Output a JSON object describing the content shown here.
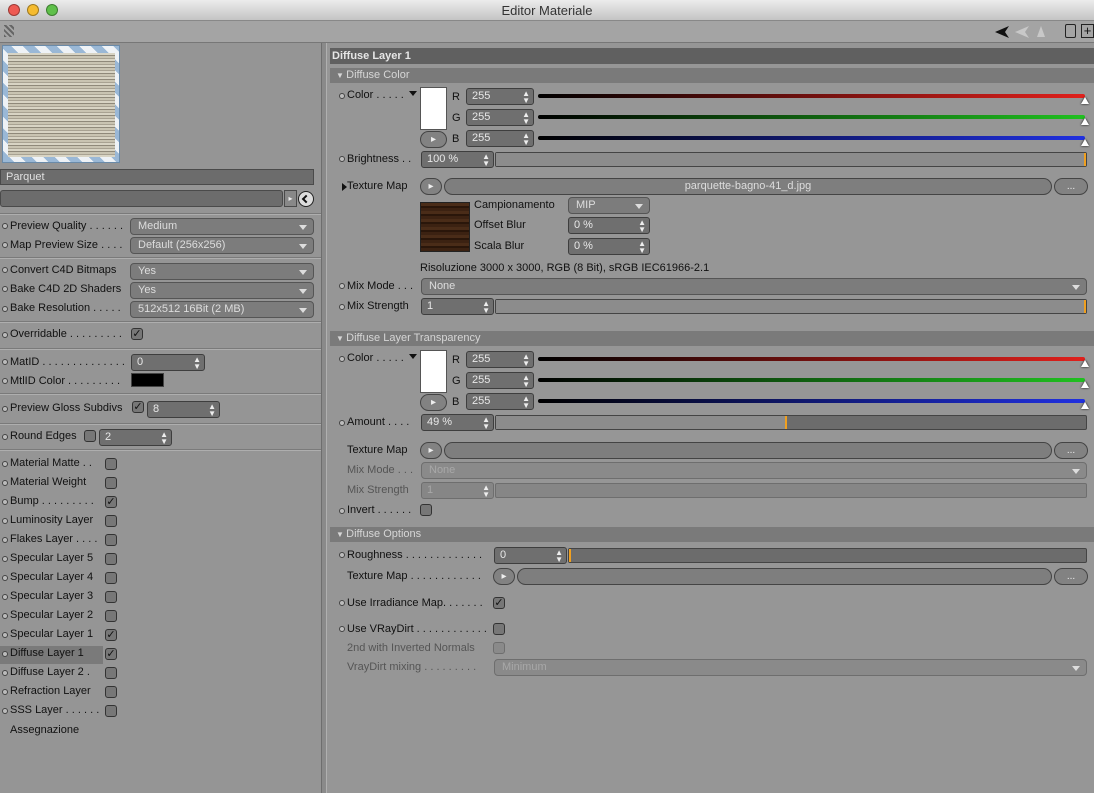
{
  "window": {
    "title": "Editor Materiale"
  },
  "left": {
    "material_name": "Parquet",
    "settings": [
      {
        "label": "Preview Quality . . . . . .",
        "value": "Medium"
      },
      {
        "label": "Map Preview Size  . . . .",
        "value": "Default (256x256)"
      }
    ],
    "bake": [
      {
        "label": "Convert C4D Bitmaps",
        "value": "Yes"
      },
      {
        "label": "Bake C4D 2D Shaders",
        "value": "Yes"
      },
      {
        "label": "Bake Resolution  . . . . .",
        "value": "512x512   16Bit   (2 MB)"
      }
    ],
    "overridable": {
      "label": "Overridable . . . . . . . . .",
      "checked": true
    },
    "matid": {
      "label": "MatID . . . . . . . . . . . . . .",
      "value": "0"
    },
    "mtlid_color": {
      "label": "MtlID Color  . . . . . . . . .",
      "color": "#000000"
    },
    "preview_gloss": {
      "label": "Preview Gloss Subdivs",
      "value": "8"
    },
    "round_edges": {
      "label": "Round Edges",
      "value": "2"
    },
    "layers": [
      {
        "label": "Material Matte . .",
        "checked": false
      },
      {
        "label": "Material Weight",
        "checked": false
      },
      {
        "label": "Bump  . . . . . . . . .",
        "checked": true
      },
      {
        "label": "Luminosity Layer",
        "checked": false
      },
      {
        "label": "Flakes Layer . . . .",
        "checked": false
      },
      {
        "label": "Specular Layer 5",
        "checked": false
      },
      {
        "label": "Specular Layer 4",
        "checked": false
      },
      {
        "label": "Specular Layer 3",
        "checked": false
      },
      {
        "label": "Specular Layer 2",
        "checked": false
      },
      {
        "label": "Specular Layer 1",
        "checked": true
      },
      {
        "label": "Diffuse Layer 1",
        "checked": true,
        "selected": true
      },
      {
        "label": "Diffuse Layer 2  .",
        "checked": false
      },
      {
        "label": "Refraction Layer",
        "checked": false
      },
      {
        "label": "SSS Layer  . . . . . .",
        "checked": false
      }
    ],
    "assignment": "Assegnazione"
  },
  "panel": {
    "title": "Diffuse Layer 1",
    "diffuse_color": {
      "header": "Diffuse Color",
      "color_label": "Color . . . . .",
      "r": "255",
      "g": "255",
      "b": "255",
      "brightness_label": "Brightness . .",
      "brightness": "100 %",
      "brightness_level": 1.0,
      "texture_map_label": "Texture Map",
      "texture_file": "parquette-bagno-41_d.jpg",
      "campionamento_label": "Campionamento",
      "campionamento": "MIP",
      "offset_blur_label": "Offset Blur",
      "offset_blur": "0 %",
      "scala_blur_label": "Scala Blur",
      "scala_blur": "0 %",
      "resolution": "Risoluzione 3000 x 3000, RGB (8 Bit), sRGB IEC61966-2.1",
      "mix_mode_label": "Mix Mode . . .",
      "mix_mode": "None",
      "mix_strength_label": "Mix Strength",
      "mix_strength": "1",
      "mix_strength_level": 1.0
    },
    "transparency": {
      "header": "Diffuse Layer Transparency",
      "color_label": "Color . . . . .",
      "r": "255",
      "g": "255",
      "b": "255",
      "amount_label": "Amount  . . . .",
      "amount": "49 %",
      "amount_level": 0.49,
      "texture_map_label": "Texture Map",
      "mix_mode_label": "Mix Mode . . .",
      "mix_mode": "None",
      "mix_strength_label": "Mix Strength",
      "mix_strength": "1",
      "invert_label": "Invert  . . . . . ."
    },
    "options": {
      "header": "Diffuse Options",
      "roughness_label": "Roughness . . . . . . . . . . . . .",
      "roughness": "0",
      "roughness_level": 0.0,
      "texture_map_label": "Texture Map  . . . . . . . . . . . .",
      "irradiance_label": "Use Irradiance Map. . . . . . .",
      "vraydirt_label": "Use VRayDirt . . . . . . . . . . . .",
      "inverted_normals_label": "2nd with Inverted Normals",
      "dirt_mixing_label": "VrayDirt mixing  . . . . . . . . .",
      "dirt_mixing": "Minimum"
    },
    "ellipsis": "...",
    "channel_labels": [
      "R",
      "G",
      "B"
    ]
  },
  "colors": {
    "red": "#e0201c",
    "green": "#20c020",
    "blue": "#2030e0",
    "accent": "#f0a020"
  }
}
